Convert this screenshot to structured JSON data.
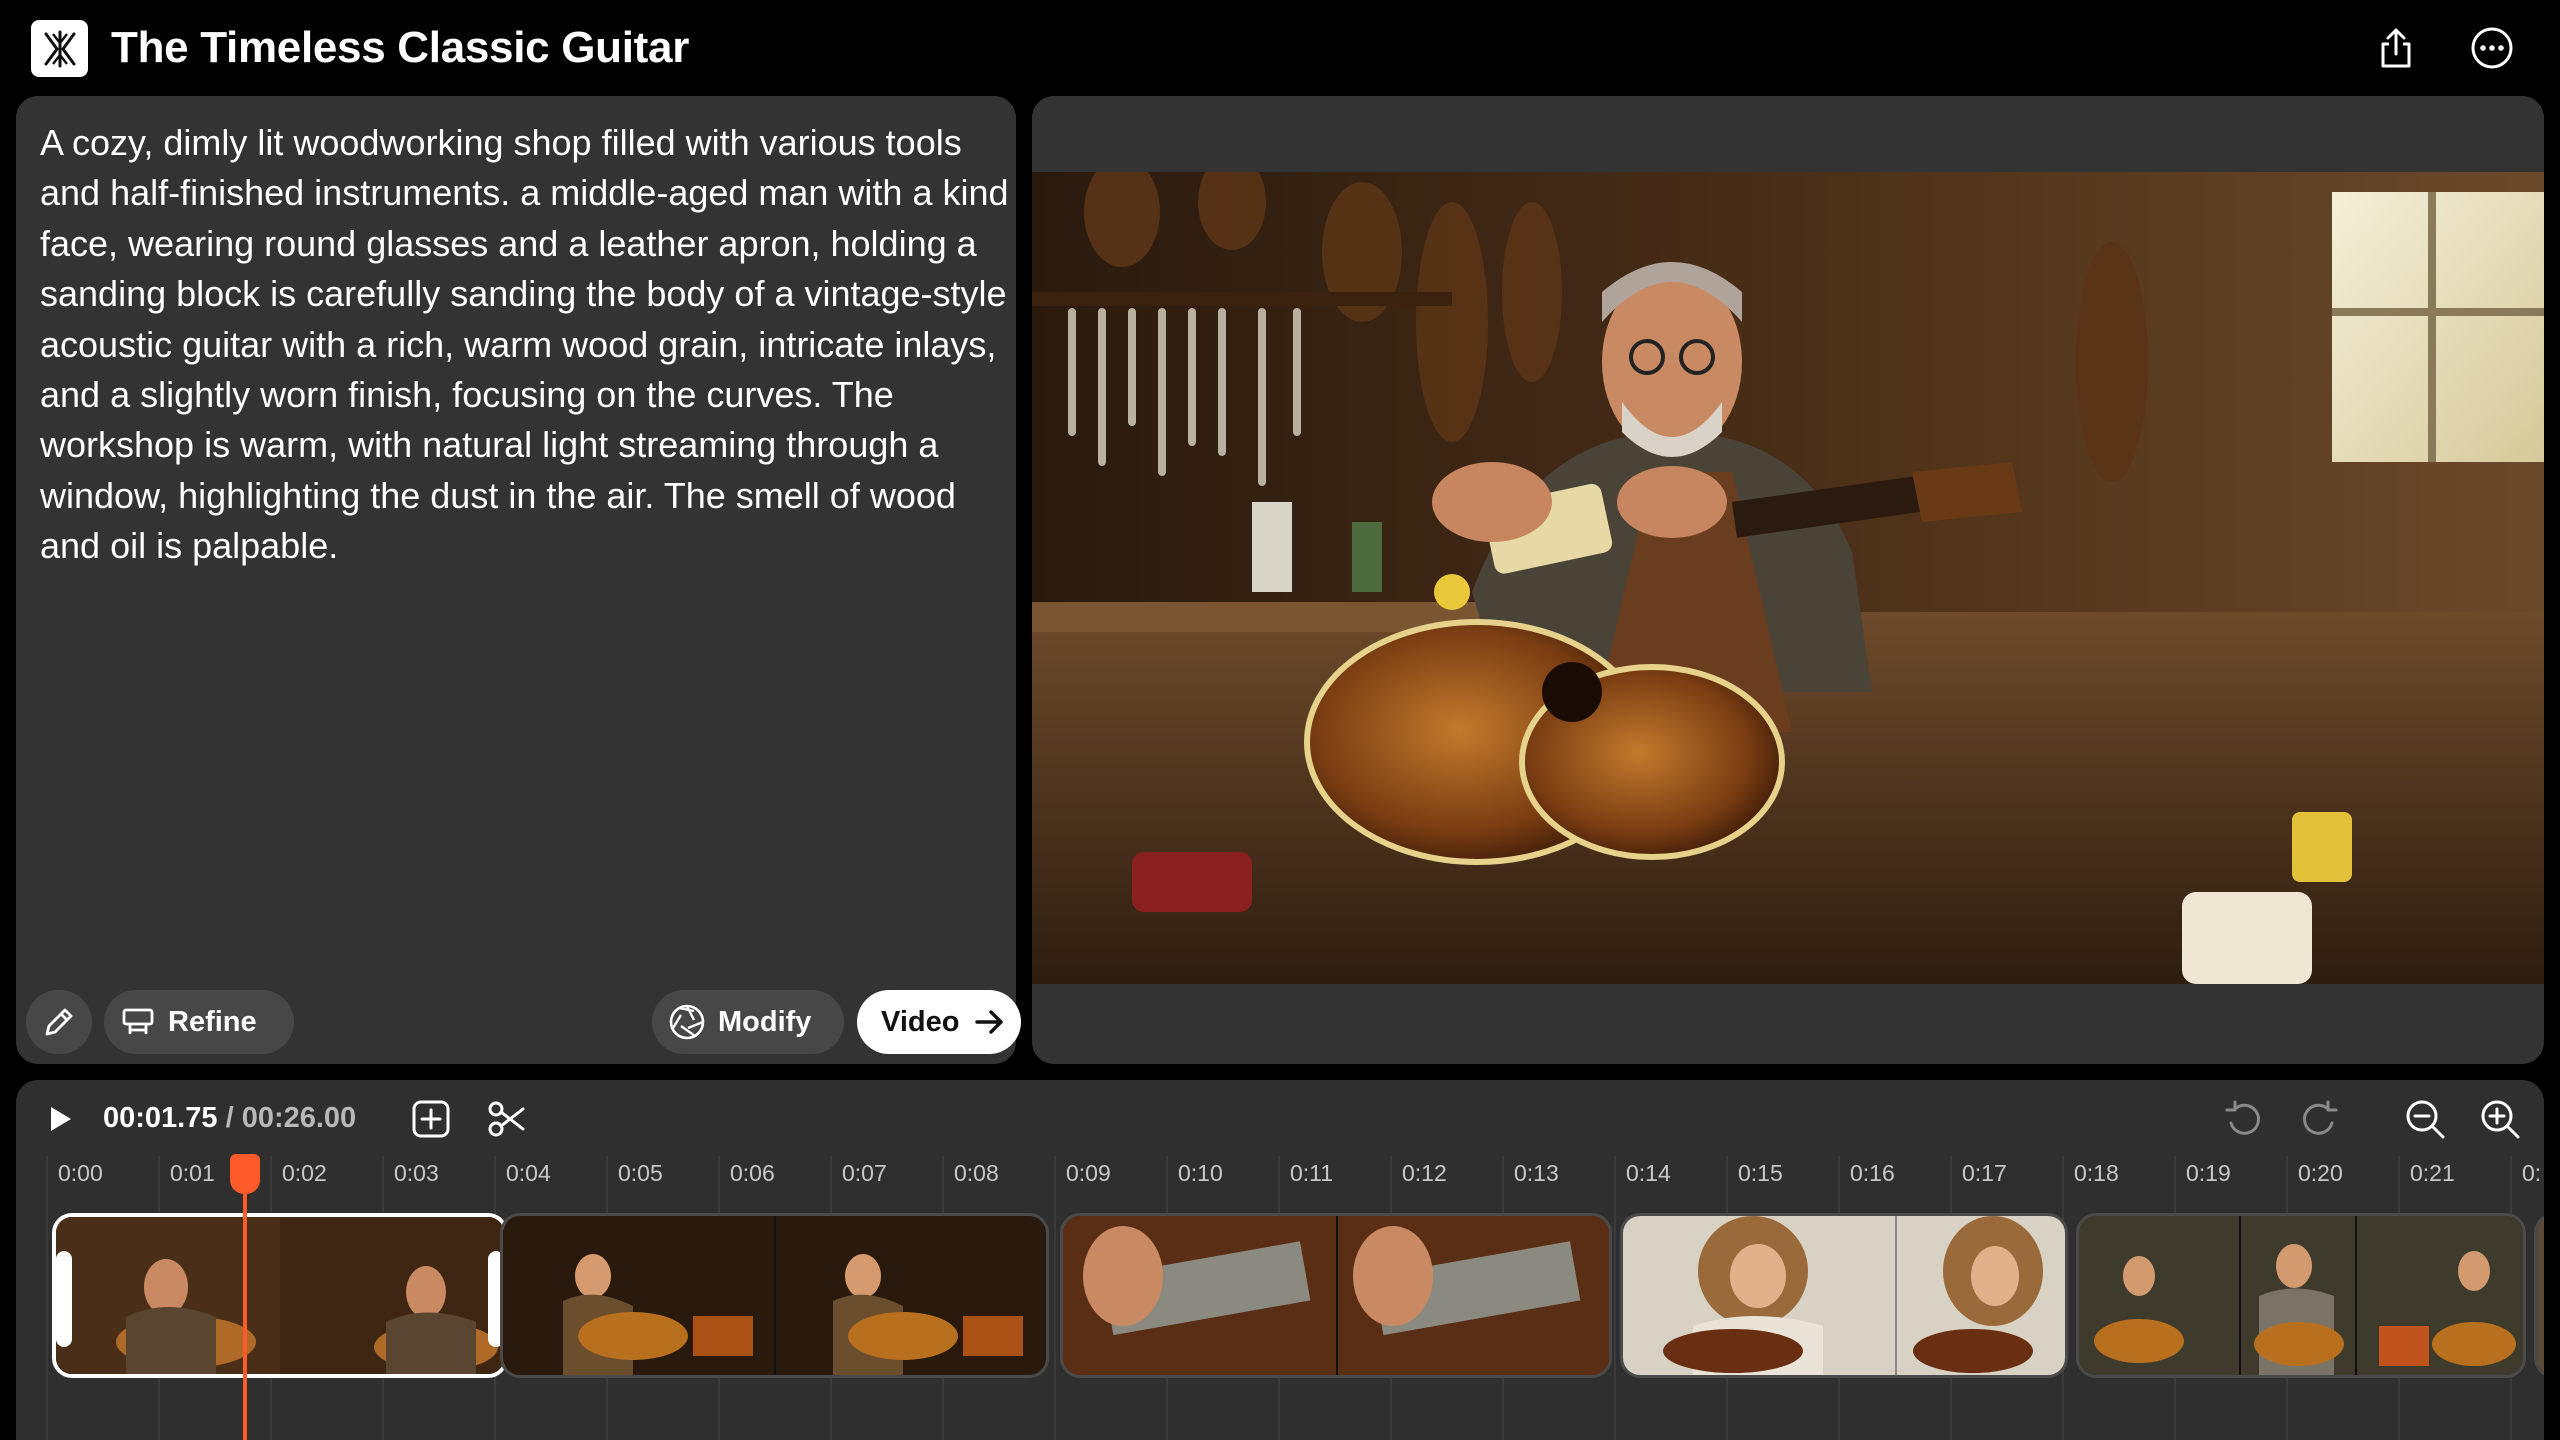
{
  "header": {
    "title": "The Timeless Classic Guitar",
    "logo_icon": "app-logo-icon",
    "share_icon": "share-icon",
    "more_icon": "more-options-icon"
  },
  "prompt": {
    "text": "A cozy, dimly lit woodworking shop filled with various tools and half-finished instruments. a middle-aged man with a kind face, wearing round glasses and a leather apron, holding a sanding block is carefully sanding the body of a vintage-style acoustic guitar with a rich, warm wood grain, intricate inlays, and a slightly worn finish, focusing on the curves. The workshop is warm, with natural light streaming through a window, highlighting the dust in the air. The smell of wood and oil is palpable.",
    "buttons": {
      "refine_label": "Refine",
      "modify_label": "Modify",
      "video_label": "Video"
    }
  },
  "timeline": {
    "current_time": "00:01.75",
    "separator": "/",
    "total_time": "00:26.00",
    "ticks": [
      "0:00",
      "0:01",
      "0:02",
      "0:03",
      "0:04",
      "0:05",
      "0:06",
      "0:07",
      "0:08",
      "0:09",
      "0:10",
      "0:11",
      "0:12",
      "0:13",
      "0:14",
      "0:15",
      "0:16",
      "0:17",
      "0:18",
      "0:19",
      "0:20",
      "0:21",
      "0:"
    ],
    "clips": [
      {
        "name": "luthier-sanding-guitar",
        "selected": true
      },
      {
        "name": "woman-playing-guitar-fireplace",
        "selected": false
      },
      {
        "name": "hand-strumming-closeup",
        "selected": false
      },
      {
        "name": "curly-hair-woman-guitar",
        "selected": false
      },
      {
        "name": "group-playing-guitars",
        "selected": false
      }
    ],
    "playhead_color": "#ff5a2a"
  },
  "colors": {
    "panel": "#333333",
    "pill": "#474747",
    "accent": "#ff5a2a"
  }
}
